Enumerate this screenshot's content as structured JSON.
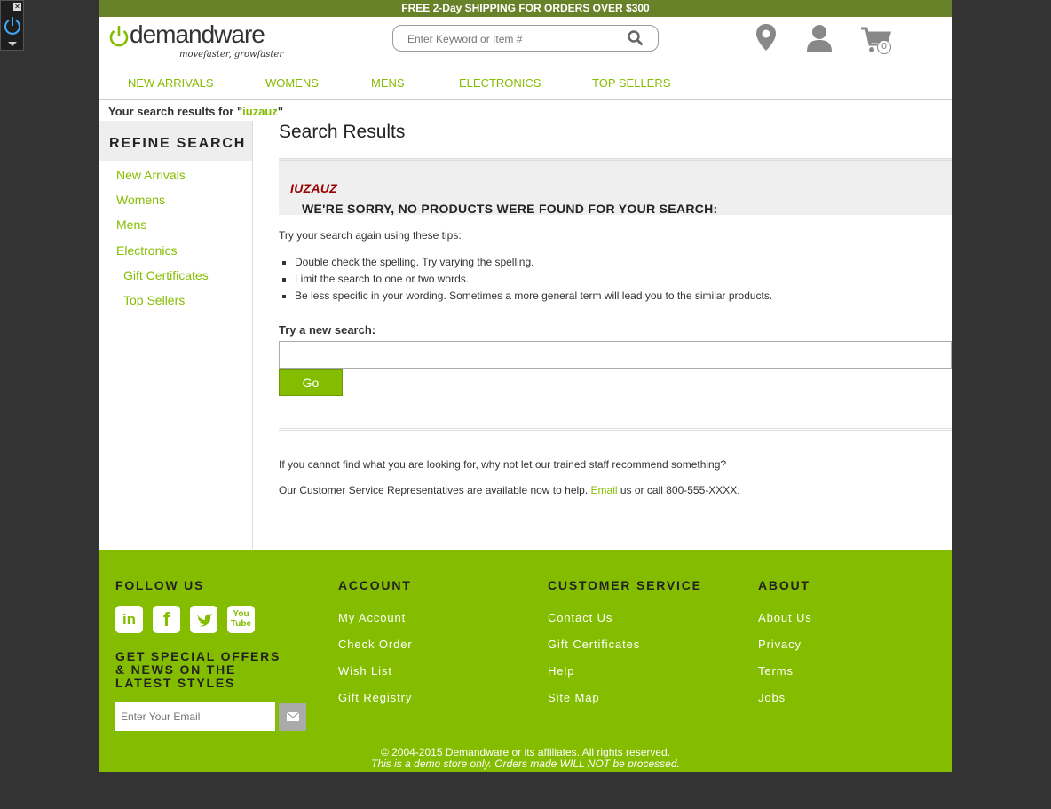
{
  "promo": {
    "pre": "FREE 2-Day ",
    "bold": "SHIPPING",
    "post": " FOR ORDERS OVER $300"
  },
  "logo": {
    "brand": "demandware",
    "tagline": "movefaster, growfaster"
  },
  "search": {
    "placeholder": "Enter Keyword or Item #"
  },
  "cart": {
    "count": "0"
  },
  "nav": {
    "items": [
      "NEW ARRIVALS",
      "WOMENS",
      "MENS",
      "ELECTRONICS",
      "TOP SELLERS"
    ]
  },
  "breadcrumb": {
    "prefix": "Your search results for \"",
    "query": "iuzauz",
    "suffix": "\""
  },
  "sidebar": {
    "title": "REFINE SEARCH",
    "items": [
      "New Arrivals",
      "Womens",
      "Mens",
      "Electronics",
      "Gift Certificates",
      "Top Sellers"
    ]
  },
  "main": {
    "title": "Search Results",
    "sorry": "WE'RE SORRY, NO PRODUCTS WERE FOUND FOR YOUR SEARCH:",
    "query": "IUZAUZ",
    "tips_intro": "Try your search again using these tips:",
    "tips": [
      "Double check the spelling. Try varying the spelling.",
      "Limit the search to one or two words.",
      "Be less specific in your wording. Sometimes a more general term will lead you to the similar products."
    ],
    "try_label": "Try a new search:",
    "go_label": "Go",
    "help1": "If you cannot find what you are looking for, why not let our trained staff recommend something?",
    "help2_pre": "Our Customer Service Representatives are available now to help.",
    "help2_link": "Email",
    "help2_post": "us or call 800-555-XXXX."
  },
  "footer": {
    "follow": "FOLLOW US",
    "account": {
      "title": "ACCOUNT",
      "links": [
        "My Account",
        "Check Order",
        "Wish List",
        "Gift Registry"
      ]
    },
    "service": {
      "title": "CUSTOMER SERVICE",
      "links": [
        "Contact Us",
        "Gift Certificates",
        "Help",
        "Site Map"
      ]
    },
    "about": {
      "title": "ABOUT",
      "links": [
        "About Us",
        "Privacy",
        "Terms",
        "Jobs"
      ]
    },
    "offers": "GET SPECIAL OFFERS & NEWS ON THE LATEST STYLES",
    "email_placeholder": "Enter Your Email",
    "copyright": "© 2004-2015 Demandware or its affiliates. All rights reserved.",
    "demo": "This is a demo store only. Orders made WILL NOT be processed.",
    "social": {
      "linkedin": "in",
      "facebook": "f",
      "youtube_1": "You",
      "youtube_2": "Tube"
    }
  },
  "colors": {
    "accent": "#84bd00",
    "promo_bar": "#68822a",
    "error_query": "#990000"
  }
}
